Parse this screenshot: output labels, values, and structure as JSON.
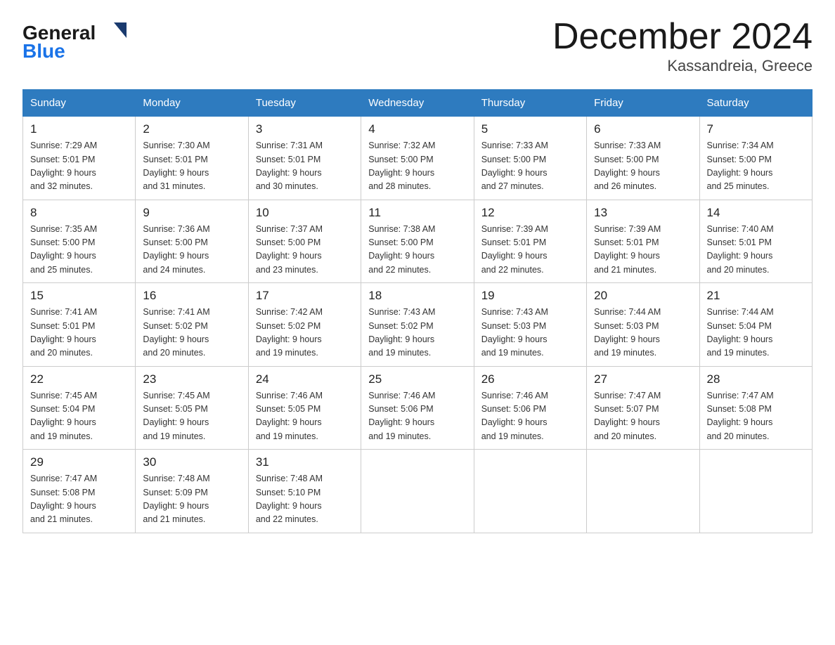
{
  "header": {
    "logo_line1": "General",
    "logo_line2": "Blue",
    "title": "December 2024",
    "subtitle": "Kassandreia, Greece"
  },
  "days_of_week": [
    "Sunday",
    "Monday",
    "Tuesday",
    "Wednesday",
    "Thursday",
    "Friday",
    "Saturday"
  ],
  "weeks": [
    [
      {
        "day": "1",
        "sunrise": "7:29 AM",
        "sunset": "5:01 PM",
        "daylight": "9 hours and 32 minutes."
      },
      {
        "day": "2",
        "sunrise": "7:30 AM",
        "sunset": "5:01 PM",
        "daylight": "9 hours and 31 minutes."
      },
      {
        "day": "3",
        "sunrise": "7:31 AM",
        "sunset": "5:01 PM",
        "daylight": "9 hours and 30 minutes."
      },
      {
        "day": "4",
        "sunrise": "7:32 AM",
        "sunset": "5:00 PM",
        "daylight": "9 hours and 28 minutes."
      },
      {
        "day": "5",
        "sunrise": "7:33 AM",
        "sunset": "5:00 PM",
        "daylight": "9 hours and 27 minutes."
      },
      {
        "day": "6",
        "sunrise": "7:33 AM",
        "sunset": "5:00 PM",
        "daylight": "9 hours and 26 minutes."
      },
      {
        "day": "7",
        "sunrise": "7:34 AM",
        "sunset": "5:00 PM",
        "daylight": "9 hours and 25 minutes."
      }
    ],
    [
      {
        "day": "8",
        "sunrise": "7:35 AM",
        "sunset": "5:00 PM",
        "daylight": "9 hours and 25 minutes."
      },
      {
        "day": "9",
        "sunrise": "7:36 AM",
        "sunset": "5:00 PM",
        "daylight": "9 hours and 24 minutes."
      },
      {
        "day": "10",
        "sunrise": "7:37 AM",
        "sunset": "5:00 PM",
        "daylight": "9 hours and 23 minutes."
      },
      {
        "day": "11",
        "sunrise": "7:38 AM",
        "sunset": "5:00 PM",
        "daylight": "9 hours and 22 minutes."
      },
      {
        "day": "12",
        "sunrise": "7:39 AM",
        "sunset": "5:01 PM",
        "daylight": "9 hours and 22 minutes."
      },
      {
        "day": "13",
        "sunrise": "7:39 AM",
        "sunset": "5:01 PM",
        "daylight": "9 hours and 21 minutes."
      },
      {
        "day": "14",
        "sunrise": "7:40 AM",
        "sunset": "5:01 PM",
        "daylight": "9 hours and 20 minutes."
      }
    ],
    [
      {
        "day": "15",
        "sunrise": "7:41 AM",
        "sunset": "5:01 PM",
        "daylight": "9 hours and 20 minutes."
      },
      {
        "day": "16",
        "sunrise": "7:41 AM",
        "sunset": "5:02 PM",
        "daylight": "9 hours and 20 minutes."
      },
      {
        "day": "17",
        "sunrise": "7:42 AM",
        "sunset": "5:02 PM",
        "daylight": "9 hours and 19 minutes."
      },
      {
        "day": "18",
        "sunrise": "7:43 AM",
        "sunset": "5:02 PM",
        "daylight": "9 hours and 19 minutes."
      },
      {
        "day": "19",
        "sunrise": "7:43 AM",
        "sunset": "5:03 PM",
        "daylight": "9 hours and 19 minutes."
      },
      {
        "day": "20",
        "sunrise": "7:44 AM",
        "sunset": "5:03 PM",
        "daylight": "9 hours and 19 minutes."
      },
      {
        "day": "21",
        "sunrise": "7:44 AM",
        "sunset": "5:04 PM",
        "daylight": "9 hours and 19 minutes."
      }
    ],
    [
      {
        "day": "22",
        "sunrise": "7:45 AM",
        "sunset": "5:04 PM",
        "daylight": "9 hours and 19 minutes."
      },
      {
        "day": "23",
        "sunrise": "7:45 AM",
        "sunset": "5:05 PM",
        "daylight": "9 hours and 19 minutes."
      },
      {
        "day": "24",
        "sunrise": "7:46 AM",
        "sunset": "5:05 PM",
        "daylight": "9 hours and 19 minutes."
      },
      {
        "day": "25",
        "sunrise": "7:46 AM",
        "sunset": "5:06 PM",
        "daylight": "9 hours and 19 minutes."
      },
      {
        "day": "26",
        "sunrise": "7:46 AM",
        "sunset": "5:06 PM",
        "daylight": "9 hours and 19 minutes."
      },
      {
        "day": "27",
        "sunrise": "7:47 AM",
        "sunset": "5:07 PM",
        "daylight": "9 hours and 20 minutes."
      },
      {
        "day": "28",
        "sunrise": "7:47 AM",
        "sunset": "5:08 PM",
        "daylight": "9 hours and 20 minutes."
      }
    ],
    [
      {
        "day": "29",
        "sunrise": "7:47 AM",
        "sunset": "5:08 PM",
        "daylight": "9 hours and 21 minutes."
      },
      {
        "day": "30",
        "sunrise": "7:48 AM",
        "sunset": "5:09 PM",
        "daylight": "9 hours and 21 minutes."
      },
      {
        "day": "31",
        "sunrise": "7:48 AM",
        "sunset": "5:10 PM",
        "daylight": "9 hours and 22 minutes."
      },
      null,
      null,
      null,
      null
    ]
  ],
  "labels": {
    "sunrise": "Sunrise:",
    "sunset": "Sunset:",
    "daylight": "Daylight:"
  }
}
